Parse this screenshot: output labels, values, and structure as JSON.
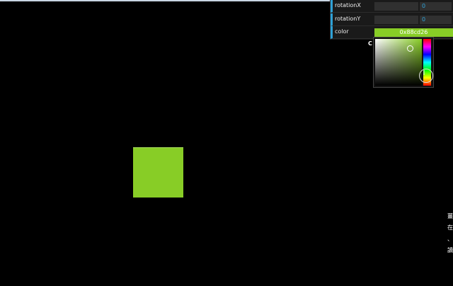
{
  "gui": {
    "rows": [
      {
        "label": "rotationX",
        "value": "0"
      },
      {
        "label": "rotationY",
        "value": "0"
      }
    ],
    "color": {
      "label": "color",
      "value": "0x88cd26",
      "swatch": "#88cd26"
    }
  },
  "picker": {
    "letter": "C"
  },
  "scene": {
    "cube_color": "#88cd26"
  },
  "edge_text": [
    "薑",
    "在",
    "、",
    "讀"
  ]
}
